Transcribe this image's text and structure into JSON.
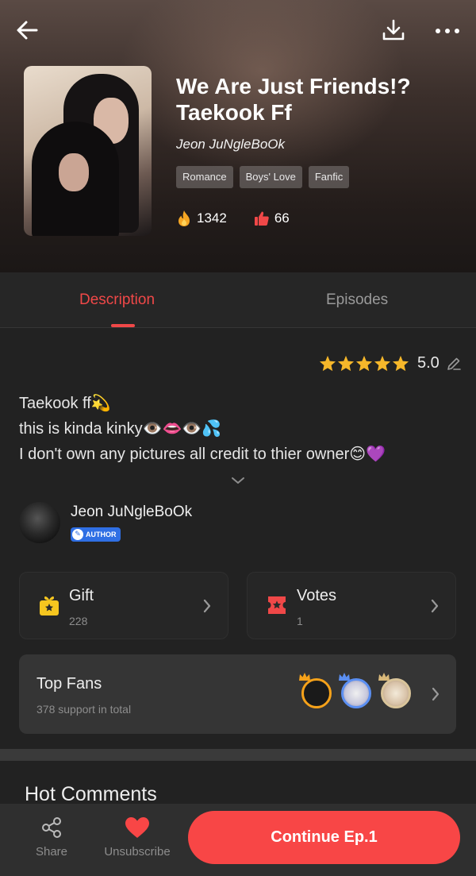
{
  "header": {
    "back_icon": "arrow-left-icon",
    "download_icon": "download-icon",
    "more_icon": "more-dots-icon"
  },
  "book": {
    "title": "We Are Just Friends!? Taekook Ff",
    "author": "Jeon JuNgleBoOk",
    "tags": [
      "Romance",
      "Boys' Love",
      "Fanfic"
    ],
    "views": "1342",
    "likes": "66"
  },
  "tabs": [
    {
      "label": "Description",
      "active": true
    },
    {
      "label": "Episodes",
      "active": false
    }
  ],
  "rating": {
    "value": "5.0",
    "stars": 5,
    "edit_icon": "pencil-icon"
  },
  "description": {
    "lines": [
      "Taekook ff💫",
      "this is kinda kinky👁️👄👁️💦",
      "I don't own any pictures all credit to thier owner😊💜"
    ]
  },
  "author_section": {
    "name": "Jeon JuNgleBoOk",
    "badge": "AUTHOR"
  },
  "gift": {
    "label": "Gift",
    "count": "228"
  },
  "votes": {
    "label": "Votes",
    "count": "1"
  },
  "top_fans": {
    "label": "Top Fans",
    "subtitle": "378 support in total"
  },
  "hot_comments": {
    "label": "Hot Comments"
  },
  "bottom_bar": {
    "share_label": "Share",
    "unsubscribe_label": "Unsubscribe",
    "continue_label": "Continue Ep.1"
  },
  "colors": {
    "accent": "#f84646",
    "tab_active": "#f04848",
    "background": "#222222"
  }
}
